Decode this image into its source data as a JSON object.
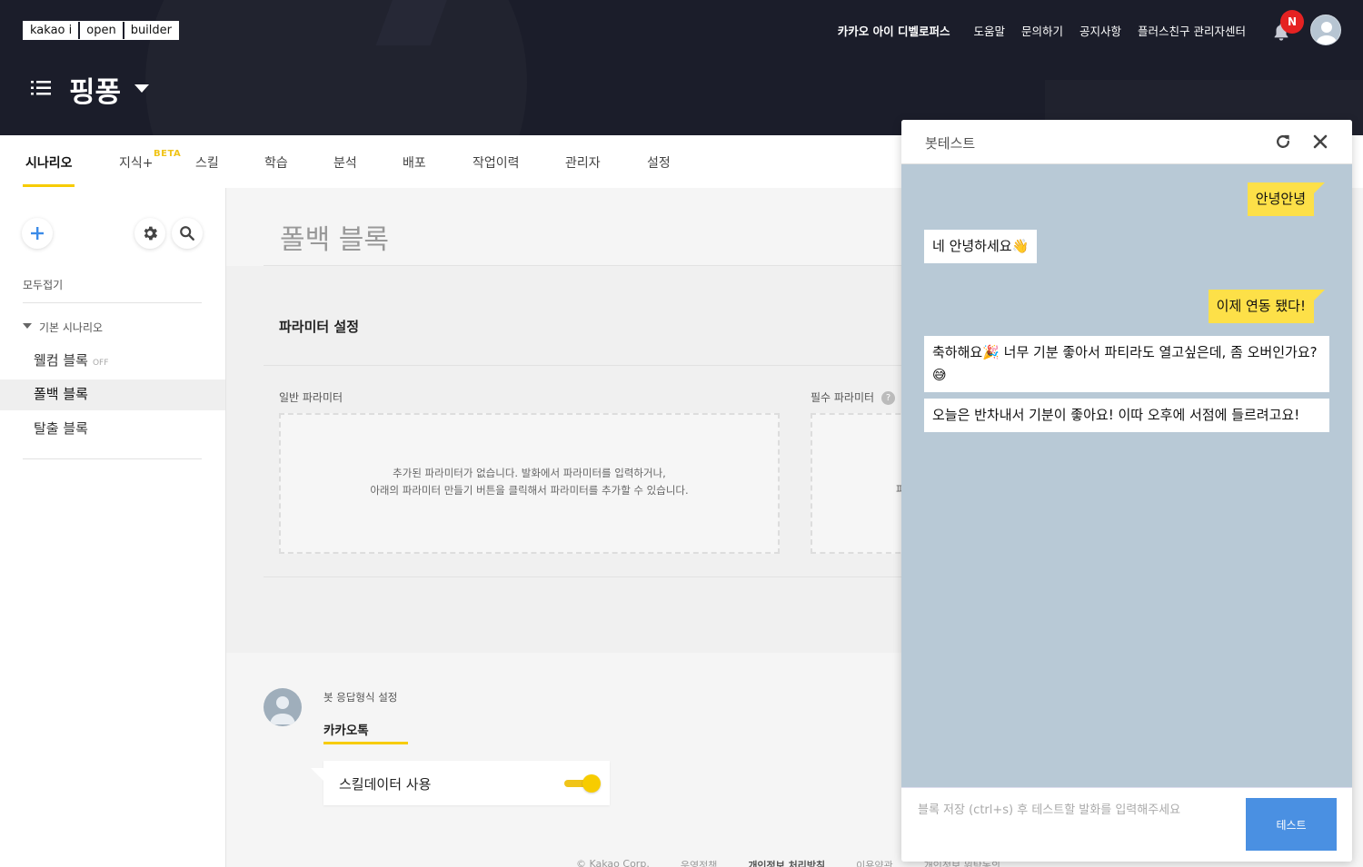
{
  "header": {
    "logo_parts": [
      "kakao i",
      "open",
      "builder"
    ],
    "nav": [
      "카카오 아이 디벨로퍼스",
      "도움말",
      "문의하기",
      "공지사항",
      "플러스친구 관리자센터"
    ],
    "notification_badge": "N",
    "bot_name": "핑퐁"
  },
  "tabs": {
    "items": [
      "시나리오",
      "지식+",
      "스킬",
      "학습",
      "분석",
      "배포",
      "작업이력",
      "관리자",
      "설정"
    ],
    "beta_label": "BETA",
    "active": "시나리오"
  },
  "sidebar": {
    "collapse_all": "모두접기",
    "group_label": "기본 시나리오",
    "items": [
      {
        "label": "웰컴 블록",
        "tag": "OFF"
      },
      {
        "label": "폴백 블록",
        "tag": ""
      },
      {
        "label": "탈출 블록",
        "tag": ""
      }
    ]
  },
  "main": {
    "block_title": "폴백 블록",
    "param_title": "파라미터 설정",
    "general_param": "일반 파라미터",
    "required_param": "필수 파라미터",
    "help_glyph": "?",
    "empty_msg_line1": "추가된 파라미터가 없습니다. 발화에서 파라미터를 입력하거나,",
    "empty_msg_line2": "아래의 파라미터 만들기 버튼을 클릭해서 파라미터를 추가할 수 있습니다.",
    "right_partial": "파",
    "response_format_label": "봇 응답형식 설정",
    "response_tab": "카카오톡",
    "skill_data_label": "스킬데이터 사용",
    "skill_data_on": true
  },
  "footer": {
    "items": [
      "© Kakao Corp.",
      "운영정책",
      "개인정보 처리방침",
      "이용약관",
      "개인정보 위탁동의"
    ]
  },
  "bot_test": {
    "title": "봇테스트",
    "messages": [
      {
        "from": "user",
        "text": "안녕안녕"
      },
      {
        "from": "bot",
        "text": "네 안녕하세요👋"
      },
      {
        "from": "user",
        "text": "이제 연동 됐다!"
      },
      {
        "from": "bot",
        "text": "축하해요🎉 너무 기분 좋아서 파티라도 열고싶은데, 좀 오버인가요?😅"
      },
      {
        "from": "bot",
        "text": "오늘은 반차내서 기분이 좋아요! 이따 오후에 서점에 들르려고요!"
      }
    ],
    "input_placeholder": "블록 저장 (ctrl+s) 후 테스트할 발화를 입력해주세요",
    "test_button": "테스트"
  },
  "colors": {
    "header_bg": "#1b1d2a",
    "accent_yellow": "#f7cc00",
    "chat_bg": "#b8c9d6",
    "test_button": "#4a90e2",
    "badge_red": "#e52222"
  }
}
